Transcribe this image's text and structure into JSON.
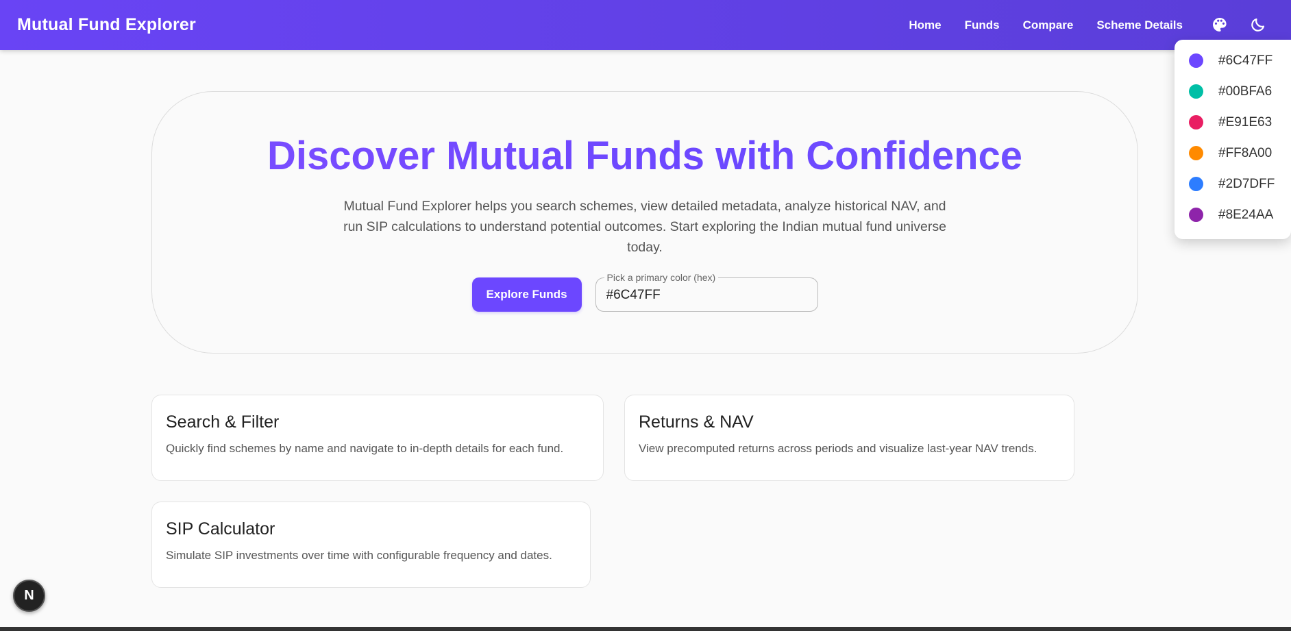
{
  "header": {
    "brand": "Mutual Fund Explorer",
    "nav": [
      "Home",
      "Funds",
      "Compare",
      "Scheme Details"
    ],
    "palette_icon": "palette-icon",
    "theme_icon": "moon-icon"
  },
  "color_menu": {
    "items": [
      {
        "label": "#6C47FF",
        "color": "#6C47FF"
      },
      {
        "label": "#00BFA6",
        "color": "#00BFA6"
      },
      {
        "label": "#E91E63",
        "color": "#E91E63"
      },
      {
        "label": "#FF8A00",
        "color": "#FF8A00"
      },
      {
        "label": "#2D7DFF",
        "color": "#2D7DFF"
      },
      {
        "label": "#8E24AA",
        "color": "#8E24AA"
      }
    ]
  },
  "hero": {
    "title": "Discover Mutual Funds with Confidence",
    "description": "Mutual Fund Explorer helps you search schemes, view detailed metadata, analyze historical NAV, and run SIP calculations to understand potential outcomes. Start exploring the Indian mutual fund universe today.",
    "cta_label": "Explore Funds",
    "color_field_label": "Pick a primary color (hex)",
    "color_field_value": "#6C47FF"
  },
  "cards": [
    {
      "title": "Search & Filter",
      "text": "Quickly find schemes by name and navigate to in-depth details for each fund."
    },
    {
      "title": "Returns & NAV",
      "text": "View precomputed returns across periods and visualize last-year NAV trends."
    },
    {
      "title": "SIP Calculator",
      "text": "Simulate SIP investments over time with configurable frequency and dates."
    }
  ],
  "dev_badge": {
    "label": "N"
  },
  "theme": {
    "primary": "#6C47FF"
  }
}
